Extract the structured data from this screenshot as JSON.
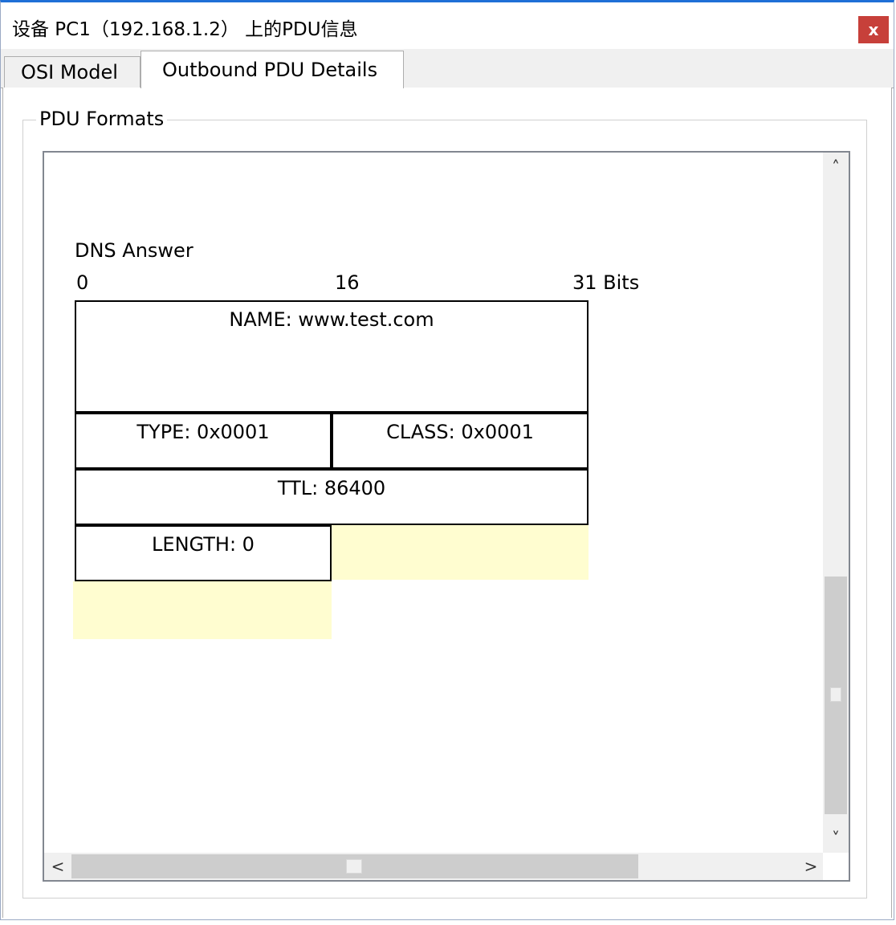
{
  "window": {
    "title": "设备 PC1（192.168.1.2） 上的PDU信息",
    "close_label": "x"
  },
  "tabs": [
    {
      "label": "OSI Model",
      "selected": false
    },
    {
      "label": "Outbound PDU Details",
      "selected": true
    }
  ],
  "group": {
    "legend": "PDU Formats"
  },
  "pdu": {
    "header": "DNS Answer",
    "bit_labels": [
      "0",
      "16",
      "31 Bits"
    ],
    "fields": {
      "name": "NAME: www.test.com",
      "type": "TYPE: 0x0001",
      "class": "CLASS: 0x0001",
      "ttl": "TTL: 86400",
      "length": "LENGTH:  0"
    }
  },
  "scrollbars": {
    "up": "˄",
    "down": "˅",
    "left": "<",
    "right": ">"
  },
  "colors": {
    "close": "#c7403a",
    "padding": "#fffdd0",
    "accent": "#1f6fd6"
  }
}
